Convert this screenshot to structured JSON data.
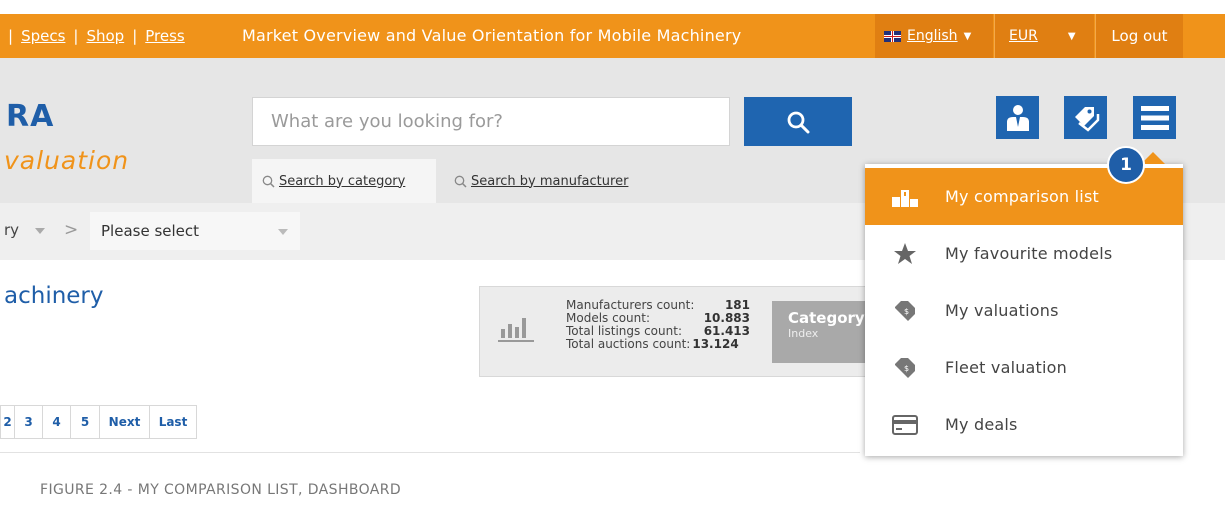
{
  "topbar": {
    "links": [
      "Specs",
      "Shop",
      "Press"
    ],
    "headline": "Market Overview and Value Orientation for Mobile Machinery",
    "language": "English",
    "currency": "EUR",
    "logout": "Log out"
  },
  "logo": {
    "main": "RA",
    "sub": "valuation"
  },
  "search": {
    "placeholder": "What are you looking for?"
  },
  "tabs": [
    {
      "label": "Search by category"
    },
    {
      "label": "Search by manufacturer"
    }
  ],
  "breadcrumb": {
    "partial": "ry",
    "select": "Please select"
  },
  "page_title": "achinery",
  "stats": {
    "rows": [
      {
        "k": "Manufacturers count:",
        "v": "181"
      },
      {
        "k": "Models count:",
        "v": "10.883"
      },
      {
        "k": "Total listings count:",
        "v": "61.413"
      },
      {
        "k": "Total auctions count:",
        "v": "13.124"
      }
    ],
    "category": {
      "title": "Category",
      "subtitle": "Index"
    }
  },
  "pager": [
    "2",
    "3",
    "4",
    "5",
    "Next",
    "Last"
  ],
  "menu": {
    "items": [
      {
        "label": "My comparison list",
        "icon": "comparison-podium-icon",
        "active": true
      },
      {
        "label": "My favourite models",
        "icon": "star-icon",
        "active": false
      },
      {
        "label": "My valuations",
        "icon": "price-tag-icon",
        "active": false
      },
      {
        "label": "Fleet valuation",
        "icon": "price-tag-icon",
        "active": false
      },
      {
        "label": "My deals",
        "icon": "credit-card-icon",
        "active": false
      }
    ],
    "badge": "1"
  },
  "caption": "FIGURE 2.4 - MY COMPARISON LIST, DASHBOARD",
  "colors": {
    "orange": "#f0931a",
    "blue": "#1f65b0"
  }
}
